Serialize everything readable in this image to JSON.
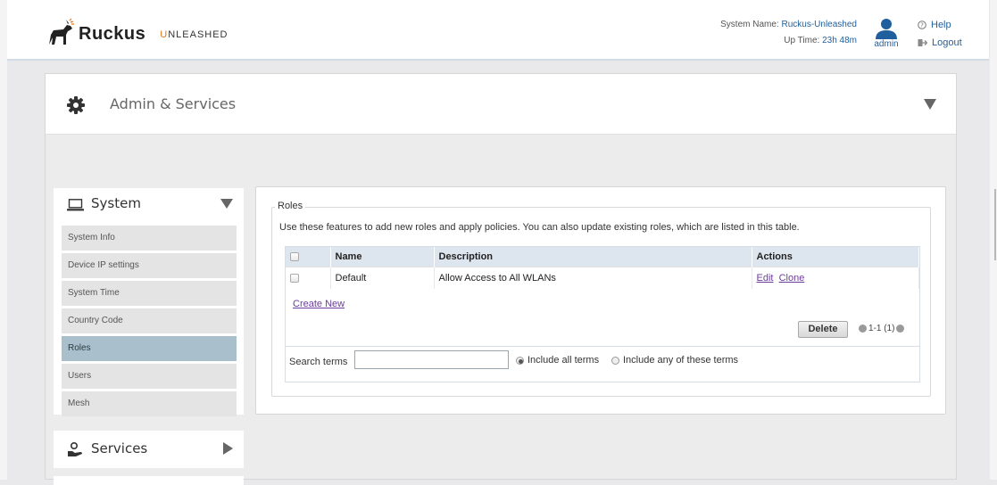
{
  "header": {
    "brand": "Ruckus",
    "sub_brand_first": "U",
    "sub_brand_rest": "NLEASHED",
    "system_name_label": "System Name:",
    "system_name_value": "Ruckus-Unleashed",
    "uptime_label": "Up Time:",
    "uptime_value": "23h 48m",
    "user_label": "admin",
    "help_label": "Help",
    "logout_label": "Logout"
  },
  "panel": {
    "title": "Admin & Services"
  },
  "sidebar": {
    "system_title": "System",
    "items": [
      {
        "label": "System Info"
      },
      {
        "label": "Device IP settings"
      },
      {
        "label": "System Time"
      },
      {
        "label": "Country Code"
      },
      {
        "label": "Roles"
      },
      {
        "label": "Users"
      },
      {
        "label": "Mesh"
      }
    ],
    "active_item": "Roles",
    "services_title": "Services"
  },
  "roles": {
    "legend": "Roles",
    "description": "Use these features to add new roles and apply policies. You can also update existing roles, which are listed in this table.",
    "columns": [
      "",
      "Name",
      "Description",
      "Actions"
    ],
    "rows": [
      {
        "name": "Default",
        "description": "Allow Access to All WLANs",
        "actions": [
          "Edit",
          "Clone"
        ]
      }
    ],
    "create_new_label": "Create New",
    "delete_label": "Delete",
    "pager_text": "1-1 (1)",
    "search_label": "Search terms",
    "search_value": "",
    "radio_all_label": "Include all terms",
    "radio_any_label": "Include any of these terms",
    "radio_selected": "all"
  },
  "colors": {
    "accent_orange": "#e3761c",
    "link_blue": "#1f5f9e",
    "link_purple": "#6a3d9a",
    "active_item_bg": "#a9bfcb",
    "table_header_bg": "#dde5ef"
  }
}
